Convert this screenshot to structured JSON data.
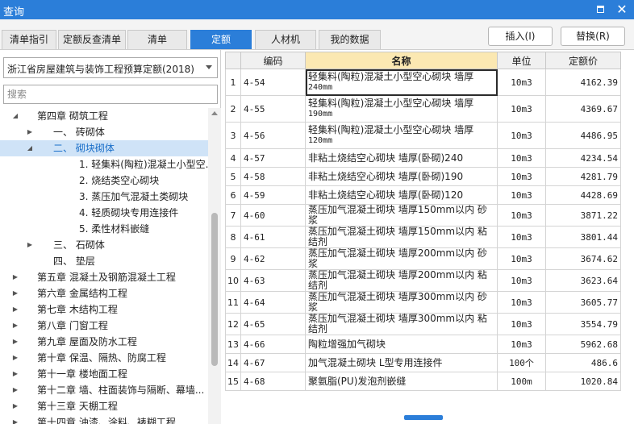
{
  "window": {
    "title": "查询"
  },
  "tabs": [
    {
      "label": "清单指引",
      "active": false
    },
    {
      "label": "定额反查清单",
      "active": false
    },
    {
      "label": "清单",
      "active": false
    },
    {
      "label": "定额",
      "active": true
    },
    {
      "label": "人材机",
      "active": false
    },
    {
      "label": "我的数据",
      "active": false
    }
  ],
  "actions": {
    "insert": "插入(I)",
    "replace": "替换(R)"
  },
  "library": {
    "selected": "浙江省房屋建筑与装饰工程预算定额(2018)"
  },
  "search": {
    "placeholder": "搜索"
  },
  "tree": [
    {
      "label": "第四章 砌筑工程",
      "level": 0,
      "expander": "expanded",
      "selected": false
    },
    {
      "label": "一、 砖砌体",
      "level": 1,
      "expander": "collapsed",
      "selected": false
    },
    {
      "label": "二、 砌块砌体",
      "level": 1,
      "expander": "expanded",
      "selected": true
    },
    {
      "label": "1. 轻集料(陶粒)混凝土小型空...",
      "level": 2,
      "expander": "none",
      "selected": false
    },
    {
      "label": "2. 烧结类空心砌块",
      "level": 2,
      "expander": "none",
      "selected": false
    },
    {
      "label": "3. 蒸压加气混凝土类砌块",
      "level": 2,
      "expander": "none",
      "selected": false
    },
    {
      "label": "4. 轻质砌块专用连接件",
      "level": 2,
      "expander": "none",
      "selected": false
    },
    {
      "label": "5. 柔性材料嵌缝",
      "level": 2,
      "expander": "none",
      "selected": false
    },
    {
      "label": "三、 石砌体",
      "level": 1,
      "expander": "collapsed",
      "selected": false
    },
    {
      "label": "四、 垫层",
      "level": 1,
      "expander": "none",
      "selected": false
    },
    {
      "label": "第五章 混凝土及钢筋混凝土工程",
      "level": 0,
      "expander": "collapsed",
      "selected": false
    },
    {
      "label": "第六章 金属结构工程",
      "level": 0,
      "expander": "collapsed",
      "selected": false
    },
    {
      "label": "第七章 木结构工程",
      "level": 0,
      "expander": "collapsed",
      "selected": false
    },
    {
      "label": "第八章 门窗工程",
      "level": 0,
      "expander": "collapsed",
      "selected": false
    },
    {
      "label": "第九章 屋面及防水工程",
      "level": 0,
      "expander": "collapsed",
      "selected": false
    },
    {
      "label": "第十章 保温、隔热、防腐工程",
      "level": 0,
      "expander": "collapsed",
      "selected": false
    },
    {
      "label": "第十一章 楼地面工程",
      "level": 0,
      "expander": "collapsed",
      "selected": false
    },
    {
      "label": "第十二章 墙、柱面装饰与隔断、幕墙...",
      "level": 0,
      "expander": "collapsed",
      "selected": false
    },
    {
      "label": "第十三章 天棚工程",
      "level": 0,
      "expander": "collapsed",
      "selected": false
    },
    {
      "label": "第十四章 油漆、涂料、裱糊工程",
      "level": 0,
      "expander": "collapsed",
      "selected": false
    }
  ],
  "table": {
    "headers": {
      "code": "编码",
      "name": "名称",
      "unit": "单位",
      "price": "定额价"
    },
    "rows": [
      {
        "index": "1",
        "code": "4-54",
        "name": "轻集料(陶粒)混凝土小型空心砌块 墙厚",
        "sub": "240mm",
        "unit": "10m3",
        "price": "4162.39",
        "current": true
      },
      {
        "index": "2",
        "code": "4-55",
        "name": "轻集料(陶粒)混凝土小型空心砌块 墙厚",
        "sub": "190mm",
        "unit": "10m3",
        "price": "4369.67"
      },
      {
        "index": "3",
        "code": "4-56",
        "name": "轻集料(陶粒)混凝土小型空心砌块 墙厚",
        "sub": "120mm",
        "unit": "10m3",
        "price": "4486.95"
      },
      {
        "index": "4",
        "code": "4-57",
        "name": "非粘土烧结空心砌块 墙厚(卧砌)240",
        "unit": "10m3",
        "price": "4234.54"
      },
      {
        "index": "5",
        "code": "4-58",
        "name": "非粘土烧结空心砌块 墙厚(卧砌)190",
        "unit": "10m3",
        "price": "4281.79"
      },
      {
        "index": "6",
        "code": "4-59",
        "name": "非粘土烧结空心砌块 墙厚(卧砌)120",
        "unit": "10m3",
        "price": "4428.69"
      },
      {
        "index": "7",
        "code": "4-60",
        "name": "蒸压加气混凝土砌块 墙厚150mm以内 砂浆",
        "unit": "10m3",
        "price": "3871.22"
      },
      {
        "index": "8",
        "code": "4-61",
        "name": "蒸压加气混凝土砌块 墙厚150mm以内 粘结剂",
        "unit": "10m3",
        "price": "3801.44"
      },
      {
        "index": "9",
        "code": "4-62",
        "name": "蒸压加气混凝土砌块 墙厚200mm以内 砂浆",
        "unit": "10m3",
        "price": "3674.62"
      },
      {
        "index": "10",
        "code": "4-63",
        "name": "蒸压加气混凝土砌块 墙厚200mm以内 粘结剂",
        "unit": "10m3",
        "price": "3623.64"
      },
      {
        "index": "11",
        "code": "4-64",
        "name": "蒸压加气混凝土砌块 墙厚300mm以内 砂浆",
        "unit": "10m3",
        "price": "3605.77"
      },
      {
        "index": "12",
        "code": "4-65",
        "name": "蒸压加气混凝土砌块 墙厚300mm以内 粘结剂",
        "unit": "10m3",
        "price": "3554.79"
      },
      {
        "index": "13",
        "code": "4-66",
        "name": "陶粒增强加气砌块",
        "unit": "10m3",
        "price": "5962.68"
      },
      {
        "index": "14",
        "code": "4-67",
        "name": "加气混凝土砌块 L型专用连接件",
        "unit": "100个",
        "price": "486.6"
      },
      {
        "index": "15",
        "code": "4-68",
        "name": "聚氨脂(PU)发泡剂嵌缝",
        "unit": "100m",
        "price": "1020.84"
      }
    ]
  }
}
